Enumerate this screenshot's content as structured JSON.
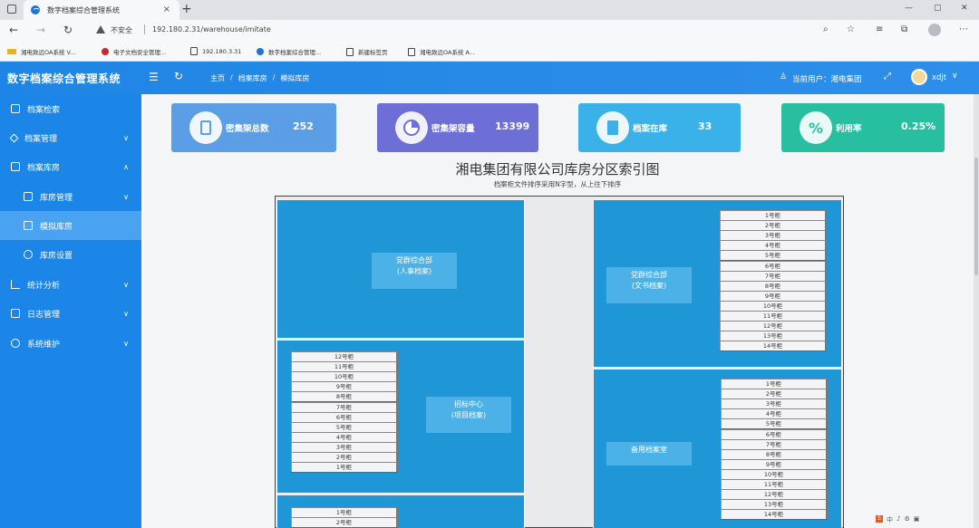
{
  "browser": {
    "tab_title": "数字档案综合管理系统",
    "tab_close": "×",
    "new_tab": "+",
    "insecure_label": "不安全",
    "url": "192.180.2.31/warehouse/imitate",
    "bookmarks": [
      "湘电致远OA系统 V...",
      "电子文档安全管理...",
      "192.180.3.31",
      "数字档案综合管理...",
      "新建标签页",
      "湘电致远OA系统 A..."
    ]
  },
  "app": {
    "title": "数字档案综合管理系统",
    "breadcrumb": [
      "主页",
      "档案库房",
      "模拟库房"
    ],
    "current_user": "当前用户：湘电集团",
    "username": "xdjt"
  },
  "sidebar": {
    "items": [
      {
        "label": "档案检索",
        "icon": "document-search-icon",
        "caret": ""
      },
      {
        "label": "档案管理",
        "icon": "edit-icon",
        "caret": "∨"
      },
      {
        "label": "档案库房",
        "icon": "bank-icon",
        "caret": "∧"
      },
      {
        "label": "库房管理",
        "icon": "grid-icon",
        "caret": "∨"
      },
      {
        "label": "模拟库房",
        "icon": "bank-icon",
        "caret": ""
      },
      {
        "label": "库房设置",
        "icon": "gear-icon",
        "caret": ""
      },
      {
        "label": "统计分析",
        "icon": "chart-icon",
        "caret": "∨"
      },
      {
        "label": "日志管理",
        "icon": "log-icon",
        "caret": "∨"
      },
      {
        "label": "系统维护",
        "icon": "gear-icon",
        "caret": "∨"
      }
    ]
  },
  "stats": [
    {
      "label": "密集架总数",
      "value": "252",
      "color": "#5c9ee6"
    },
    {
      "label": "密集架容量",
      "value": "13399",
      "color": "#6d6fd6"
    },
    {
      "label": "档案在库",
      "value": "33",
      "color": "#3bb1ea"
    },
    {
      "label": "利用率",
      "value": "0.25%",
      "color": "#27bf9f",
      "badge": "%"
    }
  ],
  "map": {
    "title": "湘电集团有限公司库房分区索引图",
    "subtitle": "档案柜文件排序采用N字型，从上往下排序",
    "zones": [
      {
        "line1": "党群综合部",
        "line2": "(人事档案)"
      },
      {
        "line1": "党群综合部",
        "line2": "(文书档案)"
      },
      {
        "line1": "招标中心",
        "line2": "(项目档案)"
      },
      {
        "line1": "备用档案室",
        "line2": ""
      }
    ],
    "cabinets_zone2": [
      "1号柜",
      "2号柜",
      "3号柜",
      "4号柜",
      "5号柜",
      "6号柜",
      "7号柜",
      "8号柜",
      "9号柜",
      "10号柜",
      "11号柜",
      "12号柜",
      "13号柜",
      "14号柜"
    ],
    "cabinets_zone3": [
      "12号柜",
      "11号柜",
      "10号柜",
      "9号柜",
      "8号柜",
      "7号柜",
      "6号柜",
      "5号柜",
      "4号柜",
      "3号柜",
      "2号柜",
      "1号柜"
    ],
    "cabinets_zone4": [
      "1号柜",
      "2号柜",
      "3号柜",
      "4号柜",
      "5号柜",
      "6号柜",
      "7号柜",
      "8号柜",
      "9号柜",
      "10号柜",
      "11号柜",
      "12号柜",
      "13号柜",
      "14号柜"
    ],
    "cabinets_zone5": [
      "1号柜",
      "2号柜"
    ]
  },
  "systray": [
    "中"
  ]
}
